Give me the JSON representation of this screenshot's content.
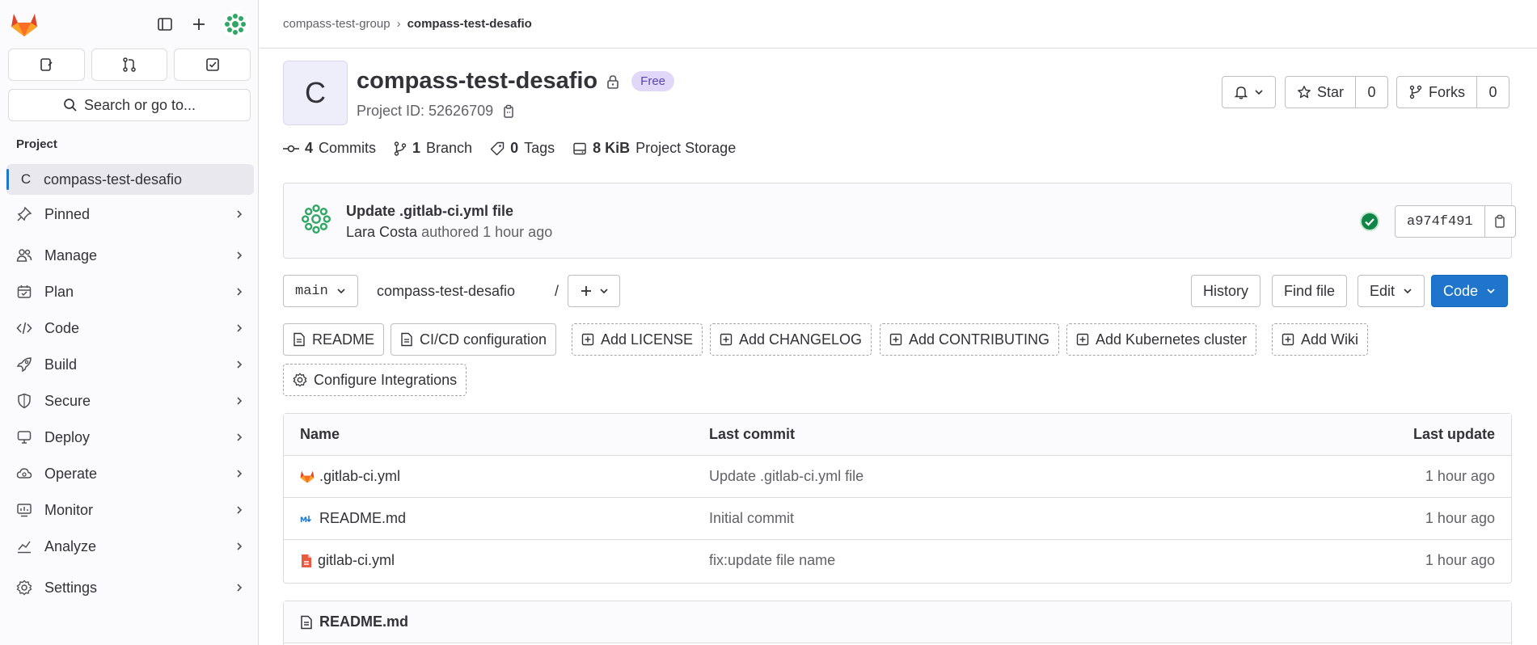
{
  "sidebar": {
    "search_label": "Search or go to...",
    "section_title": "Project",
    "project": {
      "initial": "C",
      "name": "compass-test-desafio"
    },
    "items": [
      {
        "label": "Pinned",
        "icon": "pin-icon"
      },
      {
        "label": "Manage",
        "icon": "users-icon"
      },
      {
        "label": "Plan",
        "icon": "calendar-icon"
      },
      {
        "label": "Code",
        "icon": "code-icon"
      },
      {
        "label": "Build",
        "icon": "rocket-icon"
      },
      {
        "label": "Secure",
        "icon": "shield-icon"
      },
      {
        "label": "Deploy",
        "icon": "deployments-icon"
      },
      {
        "label": "Operate",
        "icon": "cloud-gear-icon"
      },
      {
        "label": "Monitor",
        "icon": "monitor-icon"
      },
      {
        "label": "Analyze",
        "icon": "chart-icon"
      },
      {
        "label": "Settings",
        "icon": "gear-icon"
      }
    ]
  },
  "breadcrumb": {
    "group": "compass-test-group",
    "project": "compass-test-desafio"
  },
  "header": {
    "initial": "C",
    "title": "compass-test-desafio",
    "badge": "Free",
    "project_id": "Project ID: 52626709",
    "star_label": "Star",
    "star_count": "0",
    "forks_label": "Forks",
    "forks_count": "0"
  },
  "stats": {
    "commits_count": "4",
    "commits_label": "Commits",
    "branch_count": "1",
    "branch_label": "Branch",
    "tags_count": "0",
    "tags_label": "Tags",
    "storage_size": "8 KiB",
    "storage_label": "Project Storage"
  },
  "last_commit": {
    "title": "Update .gitlab-ci.yml file",
    "author": "Lara Costa",
    "meta": "authored 1 hour ago",
    "sha": "a974f491",
    "status_color": "#108548"
  },
  "tree": {
    "branch": "main",
    "path": "compass-test-desafio",
    "separator": "/",
    "history_label": "History",
    "find_file_label": "Find file",
    "edit_label": "Edit",
    "code_label": "Code"
  },
  "quick_actions": {
    "readme": "README",
    "cicd": "CI/CD configuration",
    "license": "Add LICENSE",
    "changelog": "Add CHANGELOG",
    "contributing": "Add CONTRIBUTING",
    "kubernetes": "Add Kubernetes cluster",
    "wiki": "Add Wiki",
    "integrations": "Configure Integrations"
  },
  "files": {
    "headers": {
      "name": "Name",
      "last_commit": "Last commit",
      "last_update": "Last update"
    },
    "rows": [
      {
        "name": ".gitlab-ci.yml",
        "commit": "Update .gitlab-ci.yml file",
        "updated": "1 hour ago",
        "icon": "gitlab-file-icon"
      },
      {
        "name": "README.md",
        "commit": "Initial commit",
        "updated": "1 hour ago",
        "icon": "markdown-file-icon"
      },
      {
        "name": "gitlab-ci.yml",
        "commit": "fix:update file name",
        "updated": "1 hour ago",
        "icon": "yaml-file-icon"
      }
    ]
  },
  "readme": {
    "title": "README.md"
  },
  "colors": {
    "accent": "#1f75cb",
    "badge_bg": "#e1d8f9",
    "badge_text": "#5943b6",
    "sidebar_bg": "#fbfafd"
  }
}
